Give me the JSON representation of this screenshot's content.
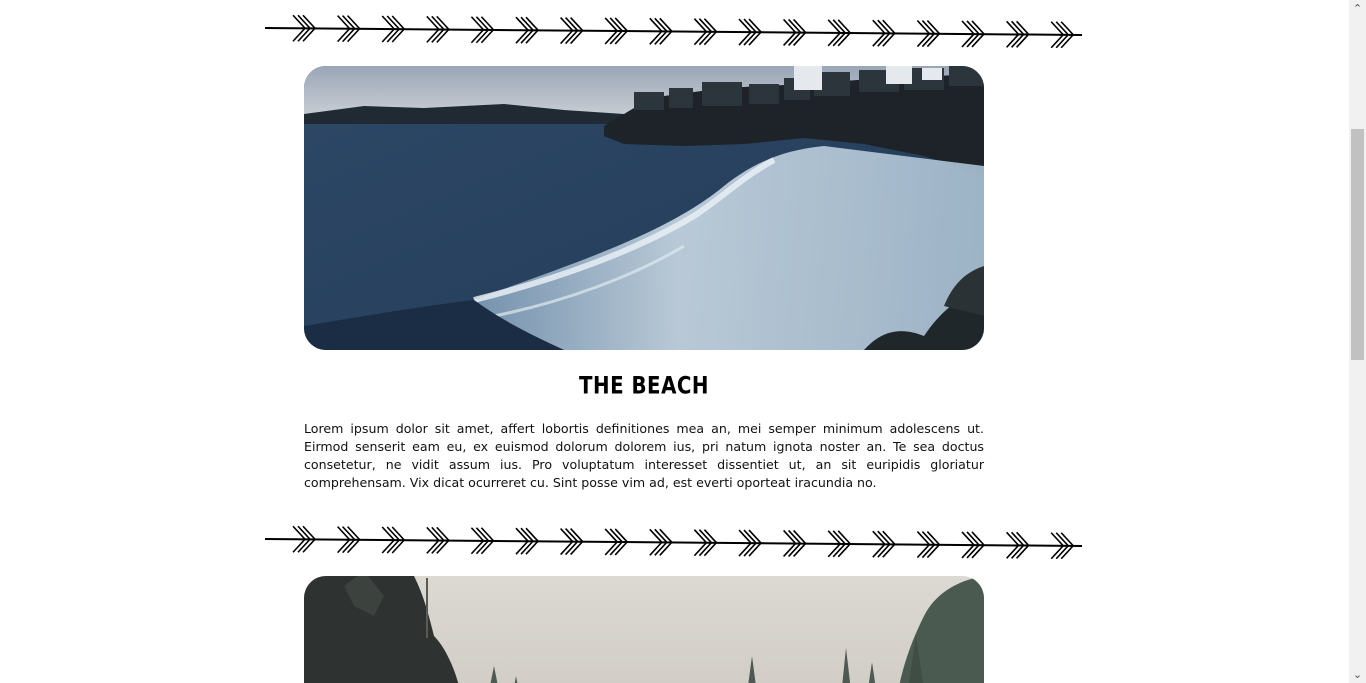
{
  "sections": [
    {
      "title": "THE BEACH",
      "body": "Lorem ipsum dolor sit amet, affert lobortis definitiones mea an, mei semper minimum adolescens ut. Eirmod senserit eam eu, ex euismod dolorum dolorem ius, pri natum ignota noster an. Te sea doctus consetetur, ne vidit assum ius. Pro voluptatum interesset dissentiet ut, an sit euripidis gloriatur comprehensam. Vix dicat ocurreret cu. Sint posse vim ad, est everti oporteat iracundia no."
    }
  ],
  "scrollbar": {
    "up_icon": "chevron-up-icon",
    "down_icon": "chevron-down-icon",
    "up_glyph": "⌃",
    "down_glyph": "⌄"
  },
  "colors": {
    "page_background": "#ffffff",
    "text": "#000000",
    "scroll_track": "#f1f1f1",
    "scroll_thumb": "#c1c1c1"
  }
}
